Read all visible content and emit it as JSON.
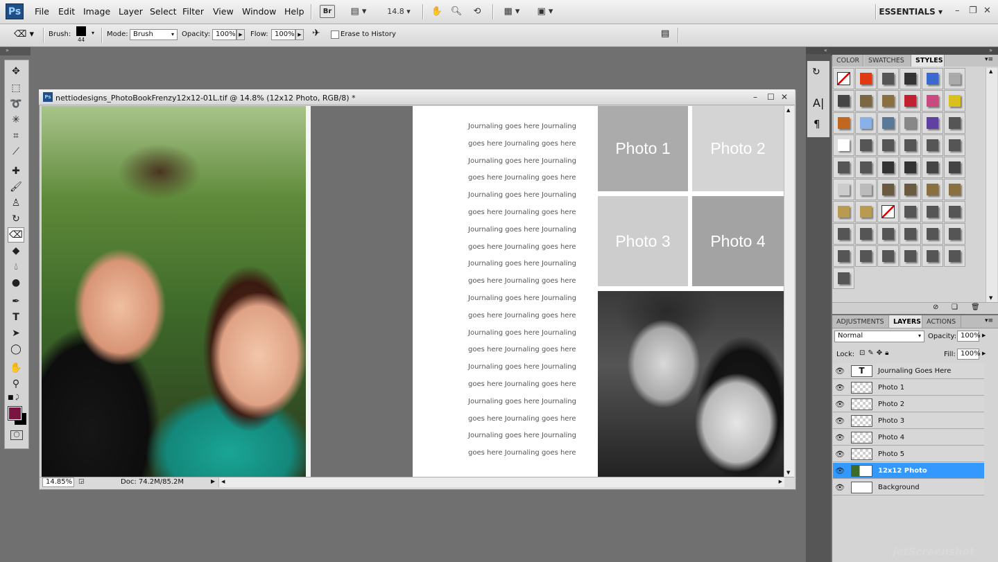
{
  "app": {
    "logo": "Ps",
    "bridge": "Br",
    "zoom_menu": "14.8",
    "workspace": "ESSENTIALS"
  },
  "menu": [
    "File",
    "Edit",
    "Image",
    "Layer",
    "Select",
    "Filter",
    "View",
    "Window",
    "Help"
  ],
  "options": {
    "brush_label": "Brush:",
    "brush_size": "44",
    "mode_label": "Mode:",
    "mode_value": "Brush",
    "opacity_label": "Opacity:",
    "opacity_value": "100%",
    "flow_label": "Flow:",
    "flow_value": "100%",
    "erase_history_label": "Erase to History"
  },
  "document": {
    "title": "nettiodesigns_PhotoBookFrenzy12x12-01L.tif @ 14.8% (12x12 Photo, RGB/8) *",
    "zoom": "14.85%",
    "doc_size": "Doc: 74.2M/85.2M",
    "journal_lines": [
      "Journaling goes here Journaling",
      "goes here Journaling goes here",
      "Journaling goes here Journaling",
      "goes here Journaling goes here",
      "Journaling goes here Journaling",
      "goes here Journaling goes here",
      "Journaling goes here Journaling",
      "goes here Journaling goes here",
      "Journaling goes here Journaling",
      "goes here Journaling goes here",
      "Journaling goes here Journaling",
      "goes here Journaling goes here",
      "Journaling goes here Journaling",
      "goes here Journaling goes here",
      "Journaling goes here Journaling",
      "goes here Journaling goes here",
      "Journaling goes here Journaling",
      "goes here Journaling goes here",
      "Journaling goes here Journaling",
      "goes here Journaling goes here"
    ],
    "photo_boxes": [
      "Photo 1",
      "Photo 2",
      "Photo 3",
      "Photo 4"
    ]
  },
  "panels": {
    "top_tabs": [
      "COLOR",
      "SWATCHES",
      "STYLES"
    ],
    "bottom_tabs": [
      "ADJUSTMENTS",
      "LAYERS",
      "ACTIONS"
    ],
    "blend_mode": "Normal",
    "opacity_label": "Opacity:",
    "opacity_value": "100%",
    "lock_label": "Lock:",
    "fill_label": "Fill:",
    "fill_value": "100%"
  },
  "layers": [
    {
      "name": "Journaling Goes Here",
      "type": "text",
      "thumb": "T"
    },
    {
      "name": "Photo 1",
      "type": "empty"
    },
    {
      "name": "Photo 2",
      "type": "empty"
    },
    {
      "name": "Photo 3",
      "type": "empty"
    },
    {
      "name": "Photo 4",
      "type": "empty"
    },
    {
      "name": "Photo 5",
      "type": "empty"
    },
    {
      "name": "12x12 Photo",
      "type": "image",
      "selected": true
    },
    {
      "name": "Background",
      "type": "white"
    }
  ],
  "styles_swatches": [
    "none",
    "#e03a10",
    "#555",
    "#333",
    "#3a6acf",
    "#aaa",
    "#444",
    "#7a6840",
    "#8a7040",
    "#c02030",
    "#c84a80",
    "#d8c020",
    "#c06820",
    "#8ab0e8",
    "#5a7898",
    "#888",
    "#6040a0",
    "#555",
    "#fff",
    "#555",
    "#555",
    "#555",
    "#555",
    "#555",
    "#555",
    "#555",
    "#333",
    "#333",
    "#444",
    "#444",
    "#ccc",
    "#bbb",
    "#6a5a40",
    "#6a5a40",
    "#8a7040",
    "#8a7040",
    "#b89a50",
    "#b89a50",
    "none",
    "#555",
    "#555",
    "#555",
    "#555",
    "#555",
    "#555",
    "#555",
    "#555",
    "#555",
    "#555",
    "#555",
    "#555",
    "#555",
    "#555",
    "#555",
    "#555"
  ],
  "colors": {
    "foreground": "#7a1440",
    "background": "#000000",
    "selection": "#3399ff"
  },
  "watermark": "jetScreenshot"
}
